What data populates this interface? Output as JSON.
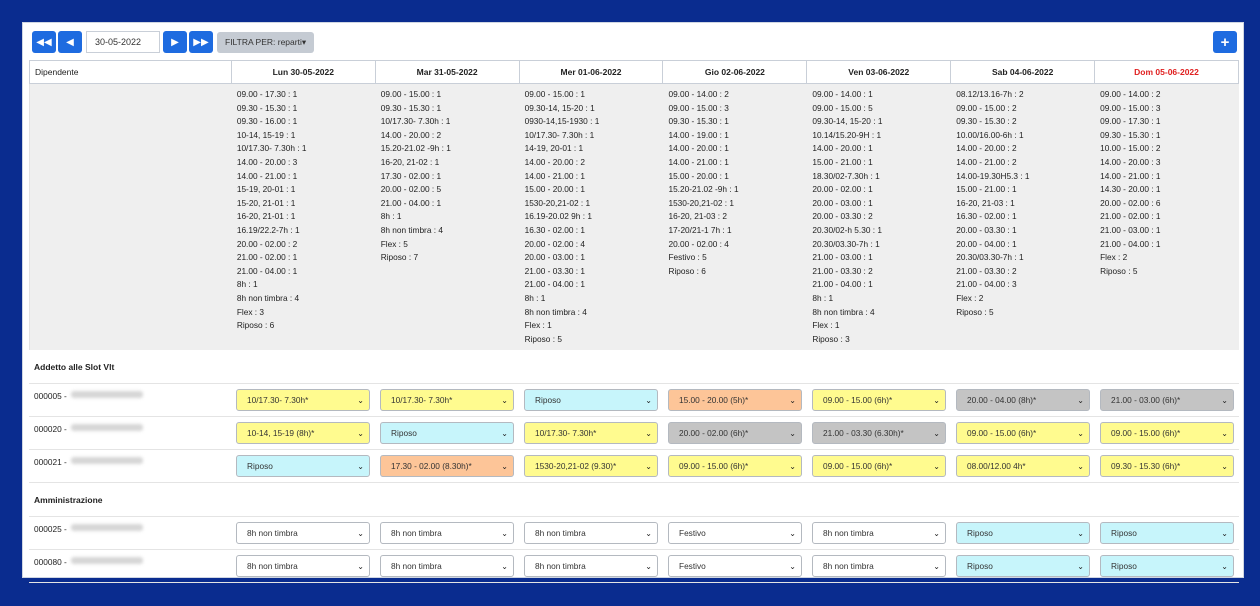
{
  "toolbar": {
    "first_icon": "double-chevron-left",
    "prev_icon": "chevron-left",
    "date_value": "30-05-2022",
    "next_icon": "chevron-right",
    "last_icon": "double-chevron-right",
    "filter_label": "FILTRA PER: reparti",
    "filter_caret": "▾",
    "add_label": "+"
  },
  "header": {
    "employee_label": "Dipendente",
    "days": [
      {
        "label": "Lun 30-05-2022",
        "weekend": false
      },
      {
        "label": "Mar 31-05-2022",
        "weekend": false
      },
      {
        "label": "Mer 01-06-2022",
        "weekend": false
      },
      {
        "label": "Gio 02-06-2022",
        "weekend": false
      },
      {
        "label": "Ven 03-06-2022",
        "weekend": false
      },
      {
        "label": "Sab 04-06-2022",
        "weekend": false
      },
      {
        "label": "Dom 05-06-2022",
        "weekend": true
      }
    ]
  },
  "summary": [
    [
      "09.00 - 17.30 : 1",
      "09.30 - 15.30 : 1",
      "09.30 - 16.00 : 1",
      "10-14, 15-19 : 1",
      "10/17.30- 7.30h : 1",
      "14.00 - 20.00 : 3",
      "14.00 - 21.00 : 1",
      "15-19, 20-01 : 1",
      "15-20, 21-01 : 1",
      "16-20, 21-01 : 1",
      "16.19/22.2-7h : 1",
      "20.00 - 02.00 : 2",
      "21.00 - 02.00 : 1",
      "21.00 - 04.00 : 1",
      "8h : 1",
      "8h non timbra : 4",
      "Flex : 3",
      "Riposo : 6"
    ],
    [
      "09.00 - 15.00 : 1",
      "09.30 - 15.30 : 1",
      "10/17.30- 7.30h : 1",
      "14.00 - 20.00 : 2",
      "15.20-21.02 -9h : 1",
      "16-20, 21-02 : 1",
      "17.30 - 02.00 : 1",
      "20.00 - 02.00 : 5",
      "21.00 - 04.00 : 1",
      "8h : 1",
      "8h non timbra : 4",
      "Flex : 5",
      "Riposo : 7"
    ],
    [
      "09.00 - 15.00 : 1",
      "09.30-14, 15-20 : 1",
      "0930-14,15-1930 : 1",
      "10/17.30- 7.30h : 1",
      "14-19, 20-01 : 1",
      "14.00 - 20.00 : 2",
      "14.00 - 21.00 : 1",
      "15.00 - 20.00 : 1",
      "1530-20,21-02 : 1",
      "16.19-20.02 9h : 1",
      "16.30 - 02.00 : 1",
      "20.00 - 02.00 : 4",
      "20.00 - 03.00 : 1",
      "21.00 - 03.30 : 1",
      "21.00 - 04.00 : 1",
      "8h : 1",
      "8h non timbra : 4",
      "Flex : 1",
      "Riposo : 5"
    ],
    [
      "09.00 - 14.00 : 2",
      "09.00 - 15.00 : 3",
      "09.30 - 15.30 : 1",
      "14.00 - 19.00 : 1",
      "14.00 - 20.00 : 1",
      "14.00 - 21.00 : 1",
      "15.00 - 20.00 : 1",
      "15.20-21.02 -9h : 1",
      "1530-20,21-02 : 1",
      "16-20, 21-03 : 2",
      "17-20/21-1 7h : 1",
      "20.00 - 02.00 : 4",
      "Festivo : 5",
      "Riposo : 6"
    ],
    [
      "09.00 - 14.00 : 1",
      "09.00 - 15.00 : 5",
      "09.30-14, 15-20 : 1",
      "10.14/15.20-9H : 1",
      "14.00 - 20.00 : 1",
      "15.00 - 21.00 : 1",
      "18.30/02-7.30h : 1",
      "20.00 - 02.00 : 1",
      "20.00 - 03.00 : 1",
      "20.00 - 03.30 : 2",
      "20.30/02-h 5.30 : 1",
      "20.30/03.30-7h : 1",
      "21.00 - 03.00 : 1",
      "21.00 - 03.30 : 2",
      "21.00 - 04.00 : 1",
      "8h : 1",
      "8h non timbra : 4",
      "Flex : 1",
      "Riposo : 3"
    ],
    [
      "08.12/13.16-7h : 2",
      "09.00 - 15.00 : 2",
      "09.30 - 15.30 : 2",
      "10.00/16.00-6h : 1",
      "14.00 - 20.00 : 2",
      "14.00 - 21.00 : 2",
      "14.00-19.30H5.3 : 1",
      "15.00 - 21.00 : 1",
      "16-20, 21-03 : 1",
      "16.30 - 02.00 : 1",
      "20.00 - 03.30 : 1",
      "20.00 - 04.00 : 1",
      "20.30/03.30-7h : 1",
      "21.00 - 03.30 : 2",
      "21.00 - 04.00 : 3",
      "Flex : 2",
      "Riposo : 5"
    ],
    [
      "09.00 - 14.00 : 2",
      "09.00 - 15.00 : 3",
      "09.00 - 17.30 : 1",
      "09.30 - 15.30 : 1",
      "10.00 - 15.00 : 2",
      "14.00 - 20.00 : 3",
      "14.00 - 21.00 : 1",
      "14.30 - 20.00 : 1",
      "20.00 - 02.00 : 6",
      "21.00 - 02.00 : 1",
      "21.00 - 03.00 : 1",
      "21.00 - 04.00 : 1",
      "Flex : 2",
      "Riposo : 5"
    ]
  ],
  "sections": [
    {
      "title": "Addetto alle Slot Vlt",
      "employees": [
        {
          "code": "000005 -",
          "shifts": [
            {
              "value": "10/17.30- 7.30h*",
              "color": "yellow"
            },
            {
              "value": "10/17.30- 7.30h*",
              "color": "yellow"
            },
            {
              "value": "Riposo",
              "color": "cyan"
            },
            {
              "value": "15.00 - 20.00 (5h)*",
              "color": "orange"
            },
            {
              "value": "09.00 - 15.00 (6h)*",
              "color": "yellow"
            },
            {
              "value": "20.00 - 04.00 (8h)*",
              "color": "gray"
            },
            {
              "value": "21.00 - 03.00 (6h)*",
              "color": "gray"
            }
          ]
        },
        {
          "code": "000020 -",
          "shifts": [
            {
              "value": "10-14, 15-19 (8h)*",
              "color": "yellow"
            },
            {
              "value": "Riposo",
              "color": "cyan"
            },
            {
              "value": "10/17.30- 7.30h*",
              "color": "yellow"
            },
            {
              "value": "20.00 - 02.00 (6h)*",
              "color": "gray"
            },
            {
              "value": "21.00 - 03.30 (6.30h)*",
              "color": "gray"
            },
            {
              "value": "09.00 - 15.00 (6h)*",
              "color": "yellow"
            },
            {
              "value": "09.00 - 15.00 (6h)*",
              "color": "yellow"
            }
          ]
        },
        {
          "code": "000021 -",
          "shifts": [
            {
              "value": "Riposo",
              "color": "cyan"
            },
            {
              "value": "17.30 - 02.00 (8.30h)*",
              "color": "orange"
            },
            {
              "value": "1530-20,21-02 (9.30)*",
              "color": "yellow"
            },
            {
              "value": "09.00 - 15.00 (6h)*",
              "color": "yellow"
            },
            {
              "value": "09.00 - 15.00 (6h)*",
              "color": "yellow"
            },
            {
              "value": "08.00/12.00 4h*",
              "color": "yellow"
            },
            {
              "value": "09.30 - 15.30 (6h)*",
              "color": "yellow"
            }
          ]
        }
      ]
    },
    {
      "title": "Amministrazione",
      "employees": [
        {
          "code": "000025 -",
          "shifts": [
            {
              "value": "8h non timbra",
              "color": "white"
            },
            {
              "value": "8h non timbra",
              "color": "white"
            },
            {
              "value": "8h non timbra",
              "color": "white"
            },
            {
              "value": "Festivo",
              "color": "white"
            },
            {
              "value": "8h non timbra",
              "color": "white"
            },
            {
              "value": "Riposo",
              "color": "cyan"
            },
            {
              "value": "Riposo",
              "color": "cyan"
            }
          ]
        },
        {
          "code": "000080 -",
          "shifts": [
            {
              "value": "8h non timbra",
              "color": "white"
            },
            {
              "value": "8h non timbra",
              "color": "white"
            },
            {
              "value": "8h non timbra",
              "color": "white"
            },
            {
              "value": "Festivo",
              "color": "white"
            },
            {
              "value": "8h non timbra",
              "color": "white"
            },
            {
              "value": "Riposo",
              "color": "cyan"
            },
            {
              "value": "Riposo",
              "color": "cyan"
            }
          ]
        }
      ]
    }
  ]
}
